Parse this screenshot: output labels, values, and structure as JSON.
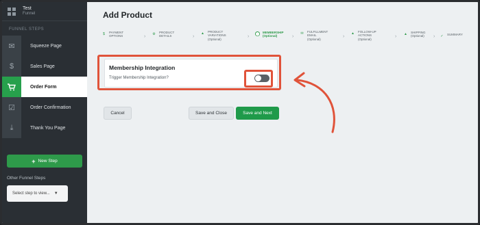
{
  "sidebar": {
    "funnel_name": "Test",
    "funnel_type": "Funnel",
    "section_label": "FUNNEL STEPS",
    "steps": [
      {
        "label": "Squeeze Page",
        "icon": "envelope-icon"
      },
      {
        "label": "Sales Page",
        "icon": "dollar-icon"
      },
      {
        "label": "Order Form",
        "icon": "cart-icon"
      },
      {
        "label": "Order Confirmation",
        "icon": "check-square-icon"
      },
      {
        "label": "Thank You Page",
        "icon": "download-icon"
      }
    ],
    "new_step_label": "New Step",
    "other_steps_label": "Other Funnel Steps",
    "select_placeholder": "Select step to view..."
  },
  "main": {
    "title": "Add Product",
    "wizard_steps": [
      {
        "line1": "PAYMENT",
        "line2": "OPTIONS",
        "line3": "",
        "icon": "$"
      },
      {
        "line1": "PRODUCT",
        "line2": "DETAILS",
        "line3": "",
        "icon": "⚙"
      },
      {
        "line1": "PRODUCT",
        "line2": "VARIATIONS",
        "line3": "(Optional)",
        "icon": "▲"
      },
      {
        "line1": "MEMBERSHIP",
        "line2": "(Optional)",
        "line3": "",
        "icon": "⬤"
      },
      {
        "line1": "FULFILLMENT",
        "line2": "EMAIL",
        "line3": "(Optional)",
        "icon": "✉"
      },
      {
        "line1": "FOLLOW-UP",
        "line2": "ACTIONS",
        "line3": "(Optional)",
        "icon": "▲"
      },
      {
        "line1": "SHIPPING",
        "line2": "(Optional)",
        "line3": "",
        "icon": "▲"
      },
      {
        "line1": "SUMMARY",
        "line2": "",
        "line3": "",
        "icon": "✓"
      }
    ],
    "card_title": "Membership Integration",
    "toggle_label": "Trigger Membership Integration?",
    "toggle_on": false,
    "buttons": {
      "cancel": "Cancel",
      "save_close": "Save and Close",
      "save_next": "Save and Next"
    }
  },
  "colors": {
    "accent": "#2e9a4a",
    "highlight": "#e0533a",
    "sidebar_bg": "#2a2f34"
  }
}
